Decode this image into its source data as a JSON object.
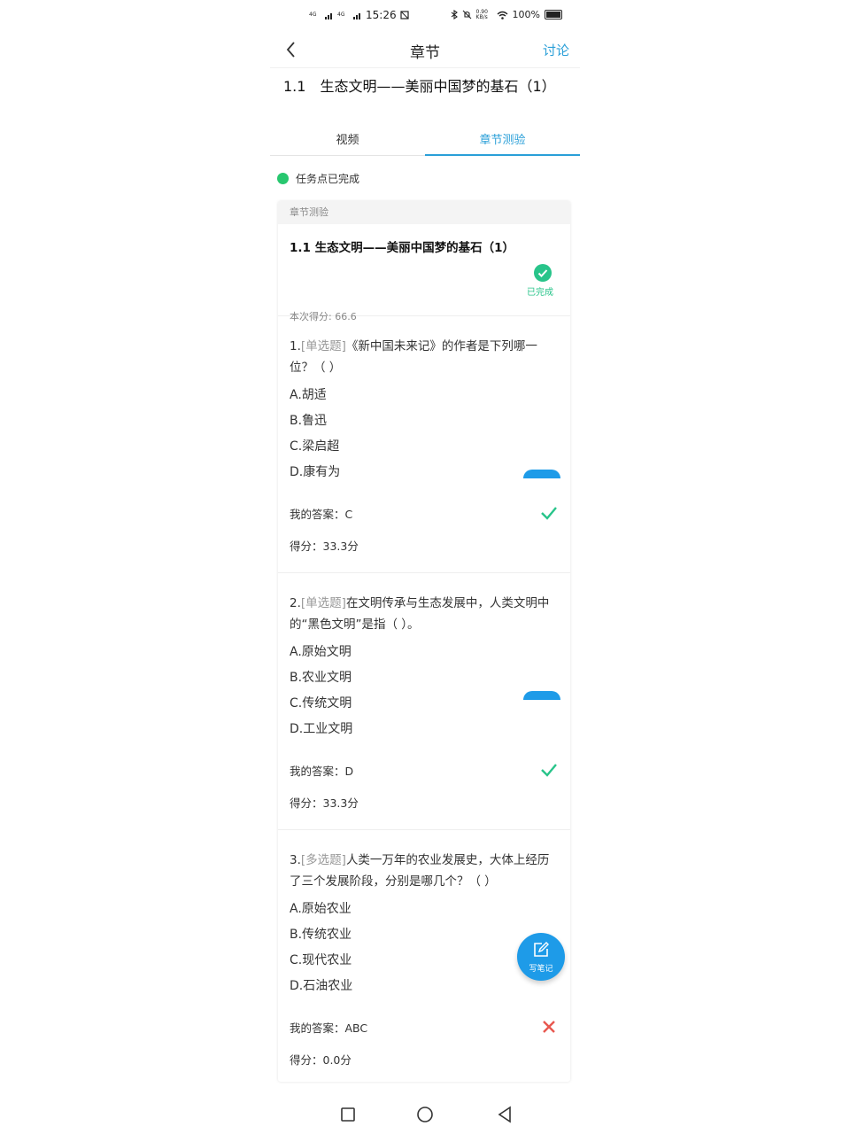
{
  "status_bar": {
    "net1": "4G",
    "net2": "4G",
    "time": "15:26",
    "speed": "0.90 KB/s",
    "battery": "100%"
  },
  "nav": {
    "title": "章节",
    "action": "讨论"
  },
  "chapter_title": "1.1　生态文明——美丽中国梦的基石（1）",
  "tabs": [
    {
      "label": "视频"
    },
    {
      "label": "章节测验"
    }
  ],
  "task_status": "任务点已完成",
  "card": {
    "header": "章节测验",
    "quiz_title": "1.1 生态文明——美丽中国梦的基石（1）",
    "done_label": "已完成",
    "score_line": "本次得分: 66.6"
  },
  "questions": [
    {
      "number": "1.",
      "type": "[单选题]",
      "stem": "《新中国未来记》的作者是下列哪一位？（ ）",
      "options": [
        "A.胡适",
        "B.鲁迅",
        "C.梁启超",
        "D.康有为"
      ],
      "answer": "我的答案：C",
      "score": "得分：33.3分",
      "result": "correct"
    },
    {
      "number": "2.",
      "type": "[单选题]",
      "stem": "在文明传承与生态发展中，人类文明中的“黑色文明”是指（ ）。",
      "options": [
        "A.原始文明",
        "B.农业文明",
        "C.传统文明",
        "D.工业文明"
      ],
      "answer": "我的答案：D",
      "score": "得分：33.3分",
      "result": "correct"
    },
    {
      "number": "3.",
      "type": "[多选题]",
      "stem": "人类一万年的农业发展史，大体上经历了三个发展阶段，分别是哪几个？（ ）",
      "options": [
        "A.原始农业",
        "B.传统农业",
        "C.现代农业",
        "D.石油农业"
      ],
      "answer": "我的答案：ABC",
      "score": "得分：0.0分",
      "result": "wrong"
    }
  ],
  "fab": {
    "label": "写笔记",
    "icon": "edit-note-icon"
  },
  "colors": {
    "accent": "#2a9fd8",
    "success": "#28c48a",
    "error": "#e8574f",
    "fab": "#1e9be8"
  }
}
